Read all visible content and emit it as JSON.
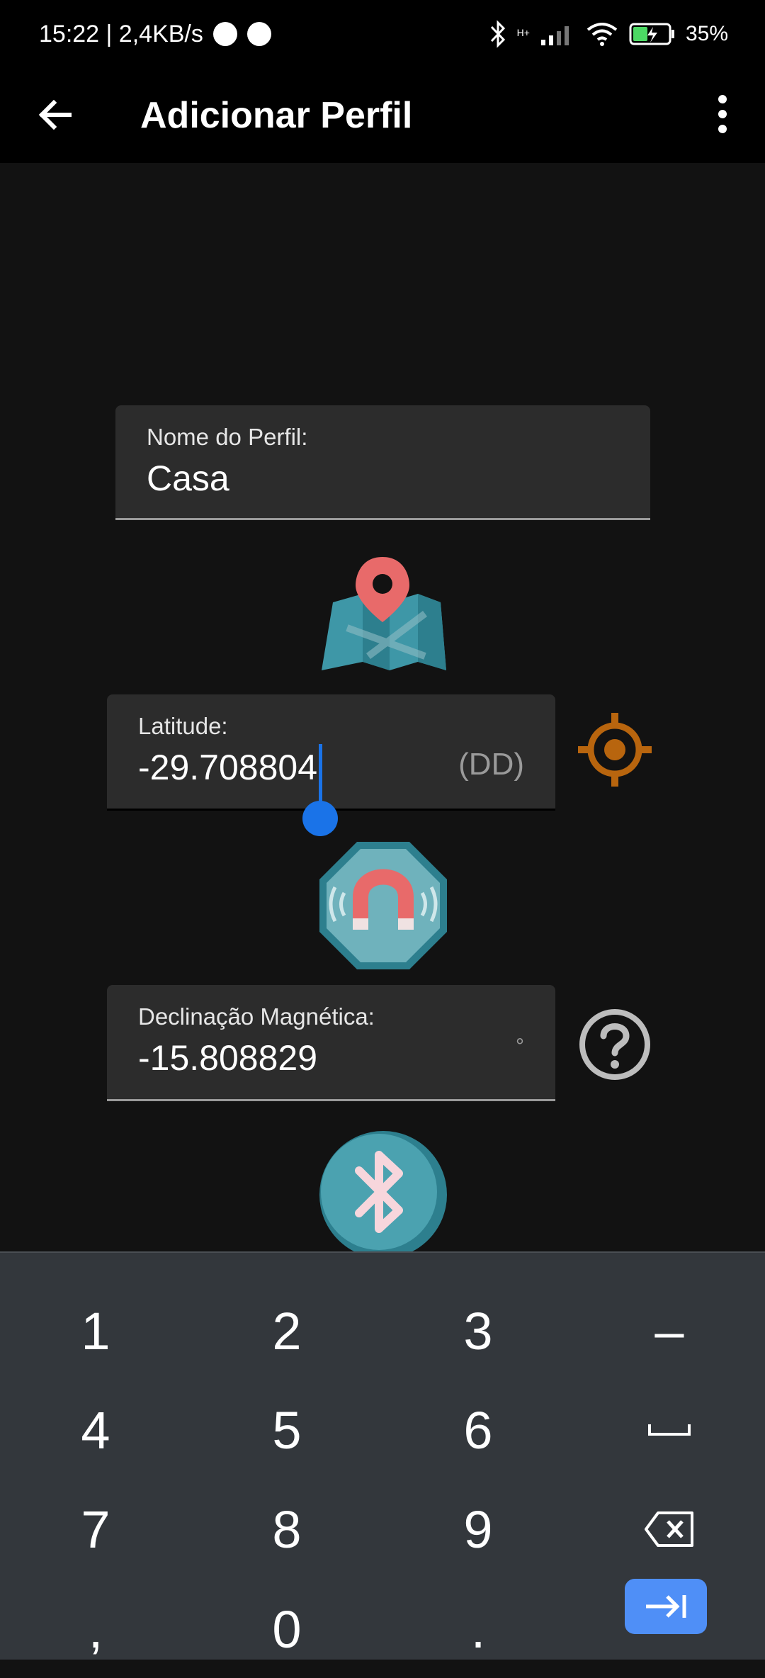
{
  "status_bar": {
    "time_speed": "15:22 | 2,4KB/s",
    "network_label": "H+",
    "battery": "35%"
  },
  "app_bar": {
    "title": "Adicionar Perfil",
    "back_icon": "arrow-left-icon",
    "menu_icon": "more-vertical-icon"
  },
  "form": {
    "profile_name": {
      "label": "Nome do Perfil:",
      "value": "Casa"
    },
    "latitude": {
      "label": "Latitude:",
      "value": "-29.708804",
      "suffix": "(DD)"
    },
    "declination": {
      "label": "Declinação Magnética:",
      "value": "-15.808829",
      "suffix": "°"
    }
  },
  "icons": {
    "map": "map-pin-icon",
    "location": "crosshair-icon",
    "magnet": "magnet-icon",
    "help": "help-circle-icon",
    "bluetooth": "bluetooth-icon"
  },
  "colors": {
    "accent": "#1a73e8",
    "location_orange": "#b8650e",
    "teal": "#3e97a7",
    "pin_red": "#e86a6a"
  },
  "keyboard": {
    "rows": [
      [
        "1",
        "2",
        "3",
        "–"
      ],
      [
        "4",
        "5",
        "6",
        "␣"
      ],
      [
        "7",
        "8",
        "9",
        "⌫"
      ],
      [
        ",",
        "0",
        ".",
        "⇥"
      ]
    ]
  }
}
